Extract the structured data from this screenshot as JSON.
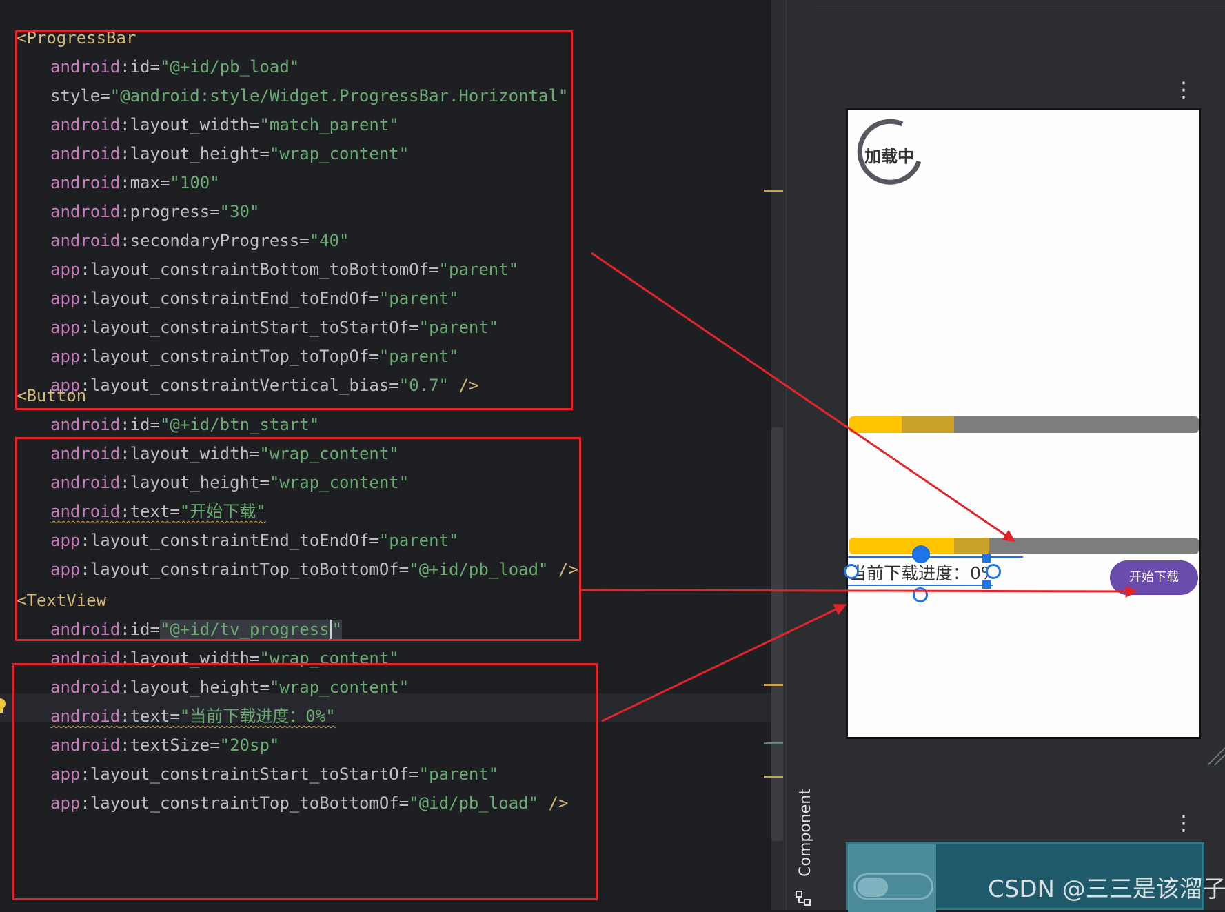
{
  "progressbar_block": {
    "open_tag": "<ProgressBar",
    "lines": [
      {
        "ns": "android",
        "attr": "id",
        "val": "\"@+id/pb_load\""
      },
      {
        "ns": "",
        "attr": "style",
        "val": "\"@android:style/Widget.ProgressBar.Horizontal\""
      },
      {
        "ns": "android",
        "attr": "layout_width",
        "val": "\"match_parent\""
      },
      {
        "ns": "android",
        "attr": "layout_height",
        "val": "\"wrap_content\""
      },
      {
        "ns": "android",
        "attr": "max",
        "val": "\"100\""
      },
      {
        "ns": "android",
        "attr": "progress",
        "val": "\"30\""
      },
      {
        "ns": "android",
        "attr": "secondaryProgress",
        "val": "\"40\""
      },
      {
        "ns": "app",
        "attr": "layout_constraintBottom_toBottomOf",
        "val": "\"parent\""
      },
      {
        "ns": "app",
        "attr": "layout_constraintEnd_toEndOf",
        "val": "\"parent\""
      },
      {
        "ns": "app",
        "attr": "layout_constraintStart_toStartOf",
        "val": "\"parent\""
      },
      {
        "ns": "app",
        "attr": "layout_constraintTop_toTopOf",
        "val": "\"parent\""
      },
      {
        "ns": "app",
        "attr": "layout_constraintVertical_bias",
        "val": "\"0.7\"",
        "close": " />"
      }
    ]
  },
  "button_block": {
    "open_tag": "<Button",
    "lines": [
      {
        "ns": "android",
        "attr": "id",
        "val": "\"@+id/btn_start\""
      },
      {
        "ns": "android",
        "attr": "layout_width",
        "val": "\"wrap_content\""
      },
      {
        "ns": "android",
        "attr": "layout_height",
        "val": "\"wrap_content\""
      },
      {
        "ns": "android",
        "attr": "text",
        "val": "\"开始下载\"",
        "warn": true
      },
      {
        "ns": "app",
        "attr": "layout_constraintEnd_toEndOf",
        "val": "\"parent\""
      },
      {
        "ns": "app",
        "attr": "layout_constraintTop_toBottomOf",
        "val": "\"@+id/pb_load\"",
        "close": " />"
      }
    ]
  },
  "textview_block": {
    "open_tag": "<TextView",
    "lines": [
      {
        "ns": "android",
        "attr": "id",
        "val": "\"@+id/tv_progress",
        "val_tail": "\"",
        "caret": true
      },
      {
        "ns": "android",
        "attr": "layout_width",
        "val": "\"wrap_content\""
      },
      {
        "ns": "android",
        "attr": "layout_height",
        "val": "\"wrap_content\""
      },
      {
        "ns": "android",
        "attr": "text",
        "val": "\"当前下载进度：0%\"",
        "warn": true
      },
      {
        "ns": "android",
        "attr": "textSize",
        "val": "\"20sp\""
      },
      {
        "ns": "app",
        "attr": "layout_constraintStart_toStartOf",
        "val": "\"parent\""
      },
      {
        "ns": "app",
        "attr": "layout_constraintTop_toBottomOf",
        "val": "\"@id/pb_load\"",
        "close": " />"
      }
    ]
  },
  "side_panel": {
    "component_tree_label": "Component Tree"
  },
  "preview": {
    "loading_label": "加载中",
    "progress_top": {
      "progress": 0.15,
      "secondary": 0.3
    },
    "progress_bottom": {
      "progress": 0.3,
      "secondary": 0.4
    },
    "textview_text": "当前下载进度：0%",
    "button_label": "开始下载"
  },
  "more_icon": "⋮",
  "watermark": "CSDN @三三是该溜子",
  "colors": {
    "annotation_red": "#e0262b",
    "progress_primary": "#ffc300",
    "progress_secondary": "#c9a028",
    "button_purple": "#6a4cad",
    "selection_blue": "#1f74e8"
  }
}
